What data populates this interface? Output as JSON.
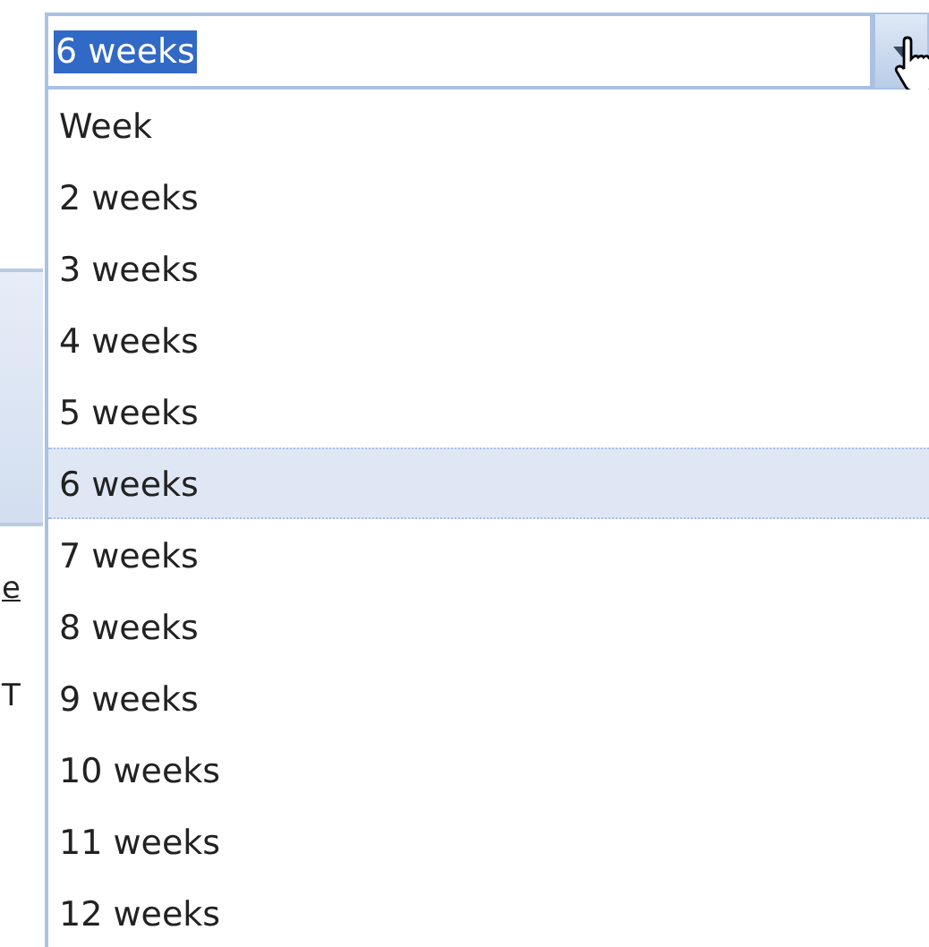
{
  "combobox": {
    "value": "6 weeks",
    "text_selected": true,
    "expanded": true
  },
  "options": [
    {
      "label": "Week",
      "selected": false
    },
    {
      "label": "2 weeks",
      "selected": false
    },
    {
      "label": "3 weeks",
      "selected": false
    },
    {
      "label": "4 weeks",
      "selected": false
    },
    {
      "label": "5 weeks",
      "selected": false
    },
    {
      "label": "6 weeks",
      "selected": true
    },
    {
      "label": "7 weeks",
      "selected": false
    },
    {
      "label": "8 weeks",
      "selected": false
    },
    {
      "label": "9 weeks",
      "selected": false
    },
    {
      "label": "10 weeks",
      "selected": false
    },
    {
      "label": "11 weeks",
      "selected": false
    },
    {
      "label": "12 weeks",
      "selected": false
    }
  ],
  "background_fragments": [
    {
      "text": "e",
      "kind": "link"
    },
    {
      "text": "T",
      "kind": "plain"
    }
  ]
}
